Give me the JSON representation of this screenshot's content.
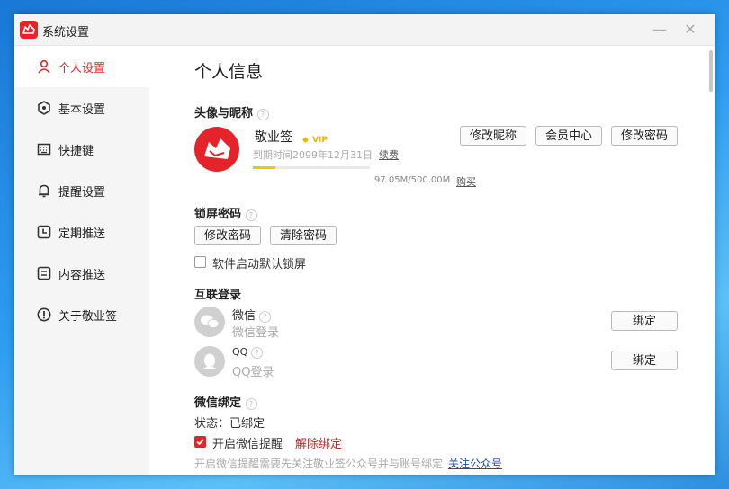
{
  "window": {
    "title": "系统设置",
    "minimize": "—",
    "close": "✕"
  },
  "sidebar": {
    "items": [
      {
        "label": "个人设置",
        "icon": "user-icon",
        "active": true
      },
      {
        "label": "基本设置",
        "icon": "settings-icon",
        "active": false
      },
      {
        "label": "快捷键",
        "icon": "keyboard-icon",
        "active": false
      },
      {
        "label": "提醒设置",
        "icon": "bell-icon",
        "active": false
      },
      {
        "label": "定期推送",
        "icon": "clock-icon",
        "active": false
      },
      {
        "label": "内容推送",
        "icon": "document-icon",
        "active": false
      },
      {
        "label": "关于敬业签",
        "icon": "info-icon",
        "active": false
      }
    ]
  },
  "main": {
    "page_title": "个人信息",
    "profile": {
      "section_title": "头像与昵称",
      "nickname": "敬业签",
      "vip": "VIP",
      "expiry": "到期时间2099年12月31日",
      "renew": "续费",
      "storage": "97.05M/500.00M",
      "storage_fraction": 0.194,
      "buy": "购买",
      "edit_nickname": "修改昵称",
      "member_center": "会员中心",
      "change_password": "修改密码"
    },
    "lock": {
      "section_title": "锁屏密码",
      "change_password": "修改密码",
      "clear_password": "清除密码",
      "auto_lock_label": "软件启动默认锁屏",
      "auto_lock_checked": false
    },
    "login": {
      "section_title": "互联登录",
      "wechat_name": "微信",
      "wechat_sub": "微信登录",
      "wechat_bind": "绑定",
      "qq_name": "QQ",
      "qq_sub": "QQ登录",
      "qq_bind": "绑定"
    },
    "wechat_bind": {
      "section_title": "微信绑定",
      "status": "状态：已绑定",
      "reminder_label": "开启微信提醒",
      "reminder_checked": true,
      "unbind": "解除绑定",
      "note": "开启微信提醒需要先关注敬业签公众号并与账号绑定",
      "follow": "关注公众号"
    }
  },
  "colors": {
    "accent": "#e5232a",
    "link": "#1f4f9a"
  }
}
